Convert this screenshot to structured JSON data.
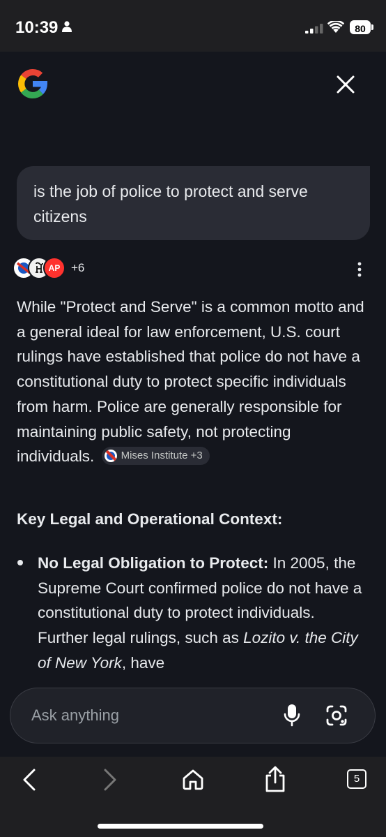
{
  "status_bar": {
    "time": "10:39",
    "battery": "80"
  },
  "query": "is the job of police to protect and serve citizens",
  "sources": {
    "icons": [
      "mises-icon",
      "nyt-icon",
      "ap-icon"
    ],
    "ap_label": "AP",
    "more": "+6"
  },
  "answer": {
    "paragraph": "While \"Protect and Serve\" is a common motto and a general ideal for law enforcement, U.S. court rulings have established that police do not have a constitutional duty to protect specific individuals from harm. Police are generally responsible for maintaining public safety, not protecting",
    "paragraph_end": "individuals.",
    "citation_chip": "Mises Institute +3",
    "heading": "Key Legal and Operational Context:",
    "bullets": [
      {
        "title": "No Legal Obligation to Protect:",
        "text_before": " In 2005, the Supreme Court confirmed police do not have a constitutional duty to protect individuals. Further legal rulings, such as ",
        "case": "Lozito v. the City of New York",
        "text_after": ", have"
      }
    ]
  },
  "ask_bar": {
    "placeholder": "Ask anything"
  },
  "toolbar": {
    "tab_count": "5"
  },
  "colors": {
    "background": "#14161d",
    "bubble": "#2a2c35",
    "text": "#e8eaed",
    "google_blue": "#4285f4",
    "google_red": "#ea4335",
    "google_yellow": "#fbbc05",
    "google_green": "#34a853"
  }
}
